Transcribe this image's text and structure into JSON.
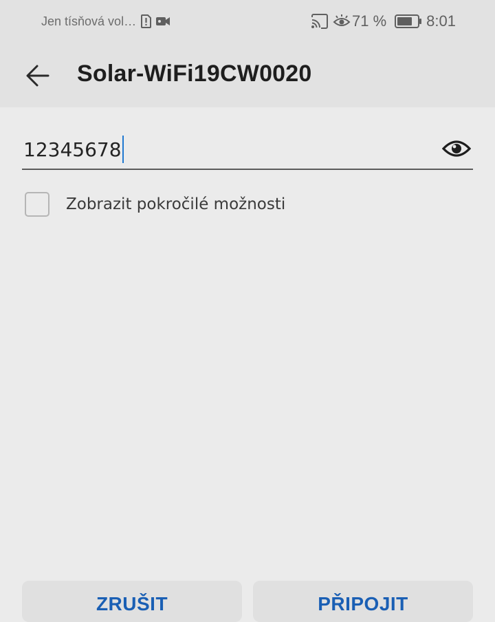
{
  "status_bar": {
    "carrier": "Jen tísňová vol…",
    "icons": [
      "sim-alert-icon",
      "video-camera-icon",
      "cast-icon",
      "eye-comfort-icon",
      "battery-icon"
    ],
    "battery_percent": "71 %",
    "time": "8:01"
  },
  "appbar": {
    "back_icon": "arrow-back-icon",
    "title": "Solar-WiFi19CW0020"
  },
  "password": {
    "value": "12345678",
    "toggle_icon": "eye-icon"
  },
  "advanced": {
    "checked": false,
    "label": "Zobrazit pokročilé možnosti"
  },
  "actions": {
    "cancel_label": "ZRUŠIT",
    "connect_label": "PŘIPOJIT"
  },
  "colors": {
    "accent": "#1a5fb4",
    "caret": "#1f78d1",
    "header_bg": "#e2e2e2",
    "body_bg": "#ebebeb"
  }
}
